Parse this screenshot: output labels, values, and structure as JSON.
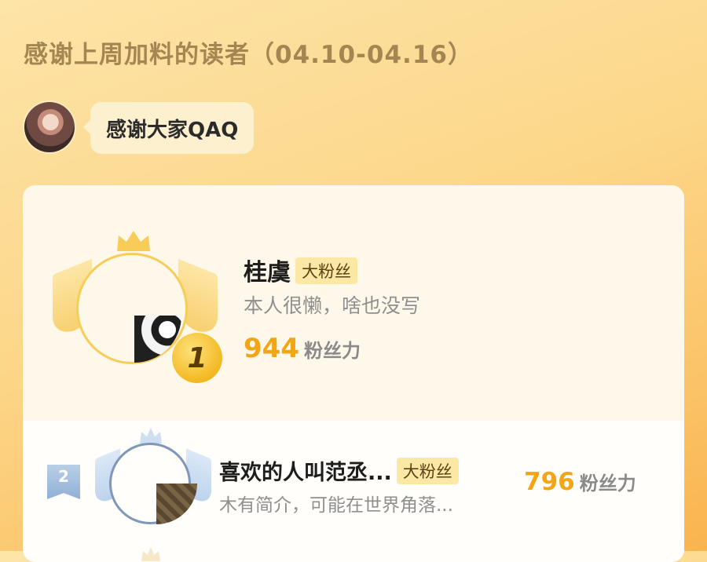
{
  "header": {
    "title": "感谢上周加料的读者（04.10-04.16）"
  },
  "author_message": {
    "text": "感谢大家QAQ"
  },
  "ranking": [
    {
      "rank": "1",
      "name": "桂虞",
      "badge": "大粉丝",
      "bio": "本人很懒，啥也没写",
      "score": "944",
      "score_unit": "粉丝力"
    },
    {
      "rank": "2",
      "name": "喜欢的人叫范丞...",
      "badge": "大粉丝",
      "bio": "木有简介，可能在世界角落...",
      "score": "796",
      "score_unit": "粉丝力"
    }
  ],
  "colors": {
    "gold_accent": "#f2a515",
    "silver_accent": "#7f98b8",
    "badge_bg": "#fbe8a4"
  },
  "icons": {
    "crown": "crown-icon",
    "wings": "wings-icon"
  }
}
